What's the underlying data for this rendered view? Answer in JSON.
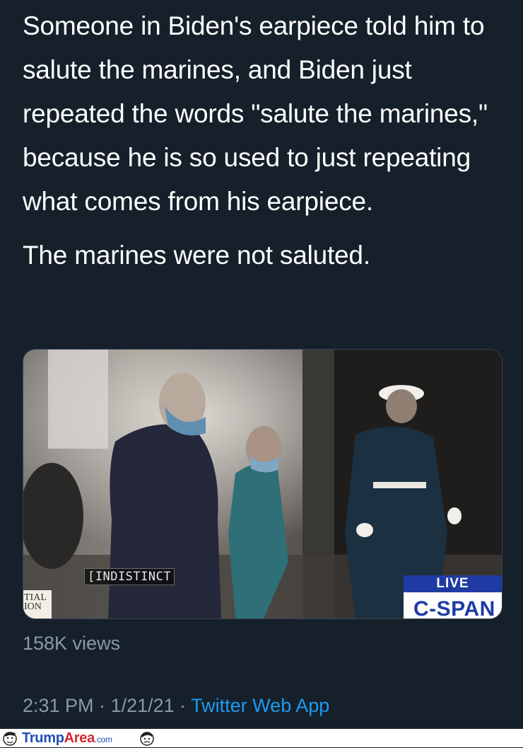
{
  "tweet": {
    "paragraphs": [
      "Someone in Biden's earpiece told him to salute the marines, and Biden just repeated the words \"salute the marines,\" because he is so used to just repeating what comes from his earpiece.",
      "The marines were not saluted."
    ]
  },
  "video": {
    "caption": "[INDISTINCT",
    "side_text": "TIAL\nION",
    "live_label": "LIVE",
    "network_logo": "C-SPAN"
  },
  "stats": {
    "views": "158K views"
  },
  "meta": {
    "time": "2:31 PM",
    "separator": " · ",
    "date": "1/21/21",
    "source": "Twitter Web App"
  },
  "watermark": {
    "brand_part1": "Trump",
    "brand_part2": "Area",
    "brand_suffix": ".com"
  },
  "colors": {
    "background": "#15202b",
    "text": "#ffffff",
    "secondary_text": "#8b98a5",
    "link": "#1d9bf0",
    "live_badge": "#1f3ba3"
  }
}
